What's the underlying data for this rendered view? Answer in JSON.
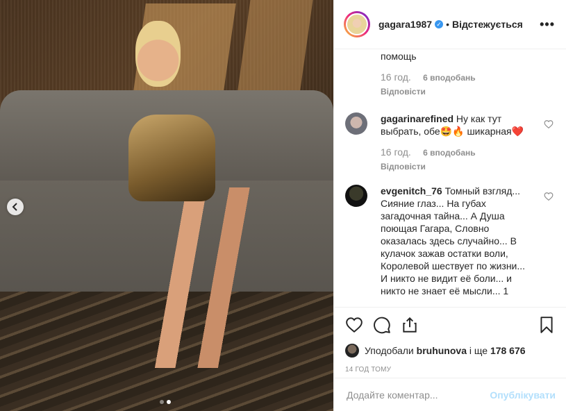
{
  "header": {
    "username": "gagara1987",
    "separator": "•",
    "follow_label": "Відстежується",
    "more_label": "•••"
  },
  "comments": [
    {
      "username": "",
      "text": "помощь",
      "time": "16 год.",
      "likes": "6 вподобань",
      "reply_label": "Відповісти"
    },
    {
      "username": "gagarinarefined",
      "text": "Ну как тут выбрать, обе🤩🔥 шикарная❤️",
      "time": "16 год.",
      "likes": "6 вподобань",
      "reply_label": "Відповісти"
    },
    {
      "username": "evgenitch_76",
      "text": "Томный взгляд... Сияние глаз... На губах загадочная тайна... А Душа поющая Гагара, Словно оказалась здесь случайно... В кулачок зажав остатки воли, Королевой шествует по жизни... И никто не видит её боли... и никто не знает её мысли... 1",
      "time": "",
      "likes": "",
      "reply_label": ""
    }
  ],
  "likes_line": {
    "prefix": "Уподобали",
    "user": "bruhunova",
    "middle": "і ще",
    "count": "178 676"
  },
  "time_ago": "14 ГОД ТОМУ",
  "add_comment": {
    "placeholder": "Додайте коментар...",
    "publish_label": "Опублікувати"
  },
  "carousel": {
    "count": 2,
    "active": 2
  }
}
